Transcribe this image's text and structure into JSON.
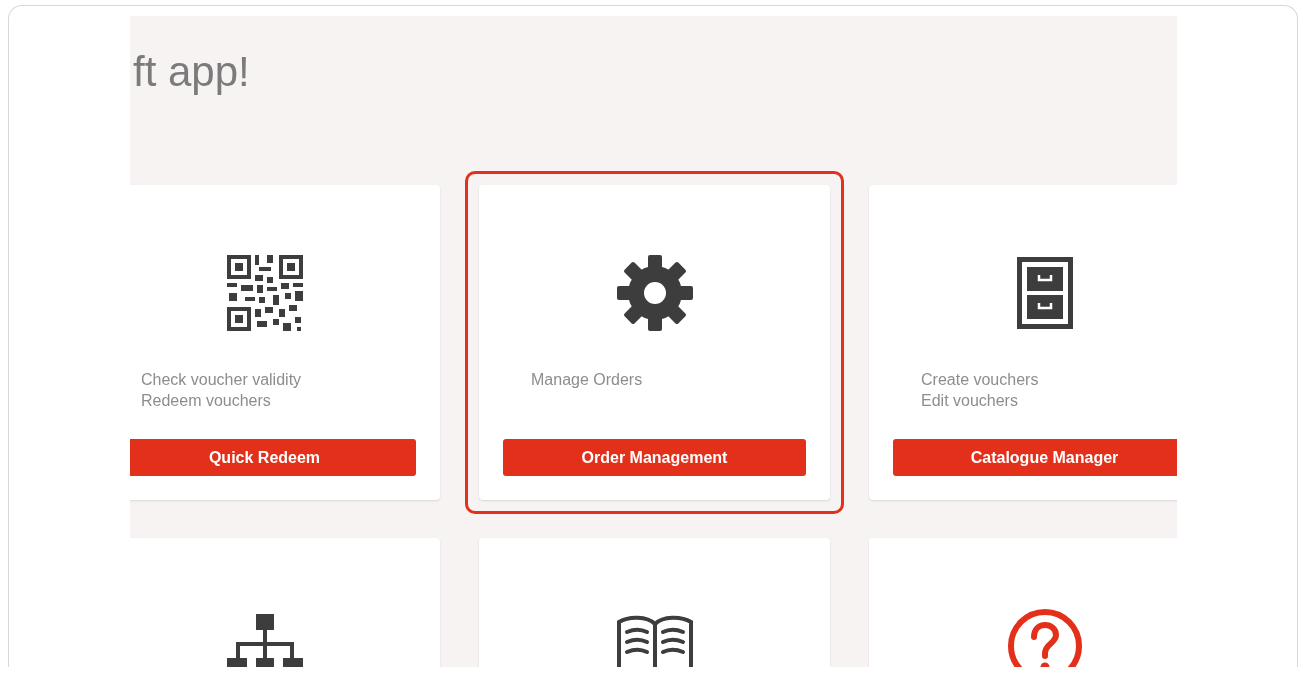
{
  "heading": "ft app!",
  "cards": [
    {
      "description": [
        "Check voucher validity",
        "Redeem vouchers"
      ],
      "button": "Quick Redeem",
      "highlighted": false
    },
    {
      "description": [
        "Manage Orders"
      ],
      "button": "Order Management",
      "highlighted": true
    },
    {
      "description": [
        "Create vouchers",
        "Edit vouchers"
      ],
      "button": "Catalogue Manager",
      "highlighted": false
    },
    {
      "highlighted": false
    },
    {
      "highlighted": false
    },
    {
      "highlighted": false
    }
  ]
}
